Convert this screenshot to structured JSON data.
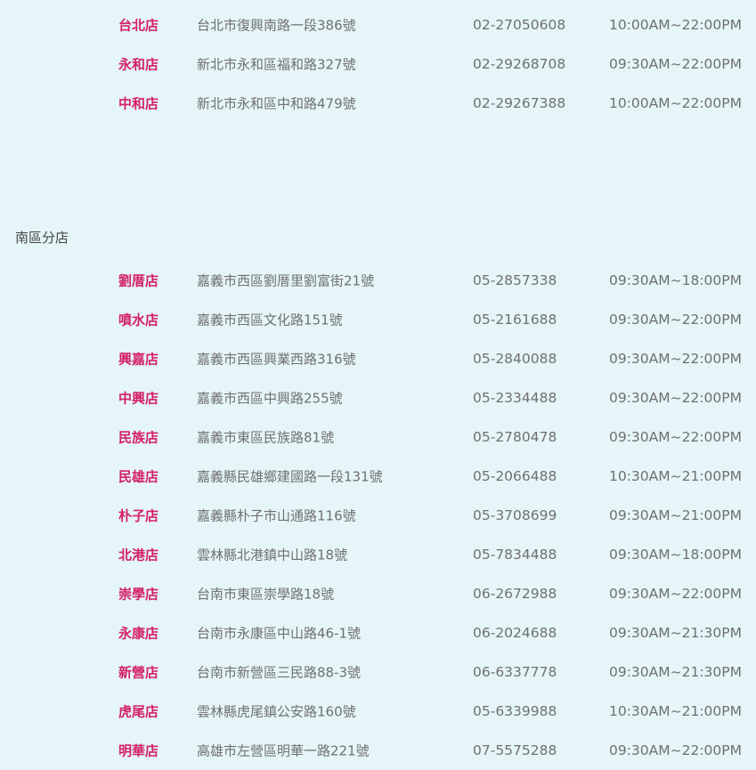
{
  "north": {
    "stores": [
      {
        "name": "台北店",
        "address": "台北市復興南路一段386號",
        "phone": "02-27050608",
        "hours": "10:00AM~22:00PM"
      },
      {
        "name": "永和店",
        "address": "新北市永和區福和路327號",
        "phone": "02-29268708",
        "hours": "09:30AM~22:00PM"
      },
      {
        "name": "中和店",
        "address": "新北市永和區中和路479號",
        "phone": "02-29267388",
        "hours": "10:00AM~22:00PM"
      }
    ]
  },
  "south": {
    "title": "南區分店",
    "stores": [
      {
        "name": "劉厝店",
        "address": "嘉義市西區劉厝里劉富街21號",
        "phone": "05-2857338",
        "hours": "09:30AM~18:00PM"
      },
      {
        "name": "噴水店",
        "address": "嘉義市西區文化路151號",
        "phone": "05-2161688",
        "hours": "09:30AM~22:00PM"
      },
      {
        "name": "興嘉店",
        "address": "嘉義市西區興業西路316號",
        "phone": "05-2840088",
        "hours": "09:30AM~22:00PM"
      },
      {
        "name": "中興店",
        "address": "嘉義市西區中興路255號",
        "phone": "05-2334488",
        "hours": "09:30AM~22:00PM"
      },
      {
        "name": "民族店",
        "address": "嘉義市東區民族路81號",
        "phone": "05-2780478",
        "hours": "09:30AM~22:00PM"
      },
      {
        "name": "民雄店",
        "address": "嘉義縣民雄鄉建國路一段131號",
        "phone": "05-2066488",
        "hours": "10:30AM~21:00PM"
      },
      {
        "name": "朴子店",
        "address": "嘉義縣朴子市山通路116號",
        "phone": "05-3708699",
        "hours": "09:30AM~21:00PM"
      },
      {
        "name": "北港店",
        "address": "雲林縣北港鎮中山路18號",
        "phone": "05-7834488",
        "hours": "09:30AM~18:00PM"
      },
      {
        "name": "崇學店",
        "address": "台南市東區崇學路18號",
        "phone": "06-2672988",
        "hours": "09:30AM~22:00PM"
      },
      {
        "name": "永康店",
        "address": "台南市永康區中山路46-1號",
        "phone": "06-2024688",
        "hours": "09:30AM~21:30PM"
      },
      {
        "name": "新營店",
        "address": "台南市新營區三民路88-3號",
        "phone": "06-6337778",
        "hours": "09:30AM~21:30PM"
      },
      {
        "name": "虎尾店",
        "address": "雲林縣虎尾鎮公安路160號",
        "phone": "05-6339988",
        "hours": "10:30AM~21:00PM"
      },
      {
        "name": "明華店",
        "address": "高雄市左營區明華一路221號",
        "phone": "07-5575288",
        "hours": "09:30AM~22:00PM"
      }
    ]
  },
  "colors": {
    "background": "#e5f5f8",
    "store_name": "#d4206a",
    "text": "#707070"
  }
}
